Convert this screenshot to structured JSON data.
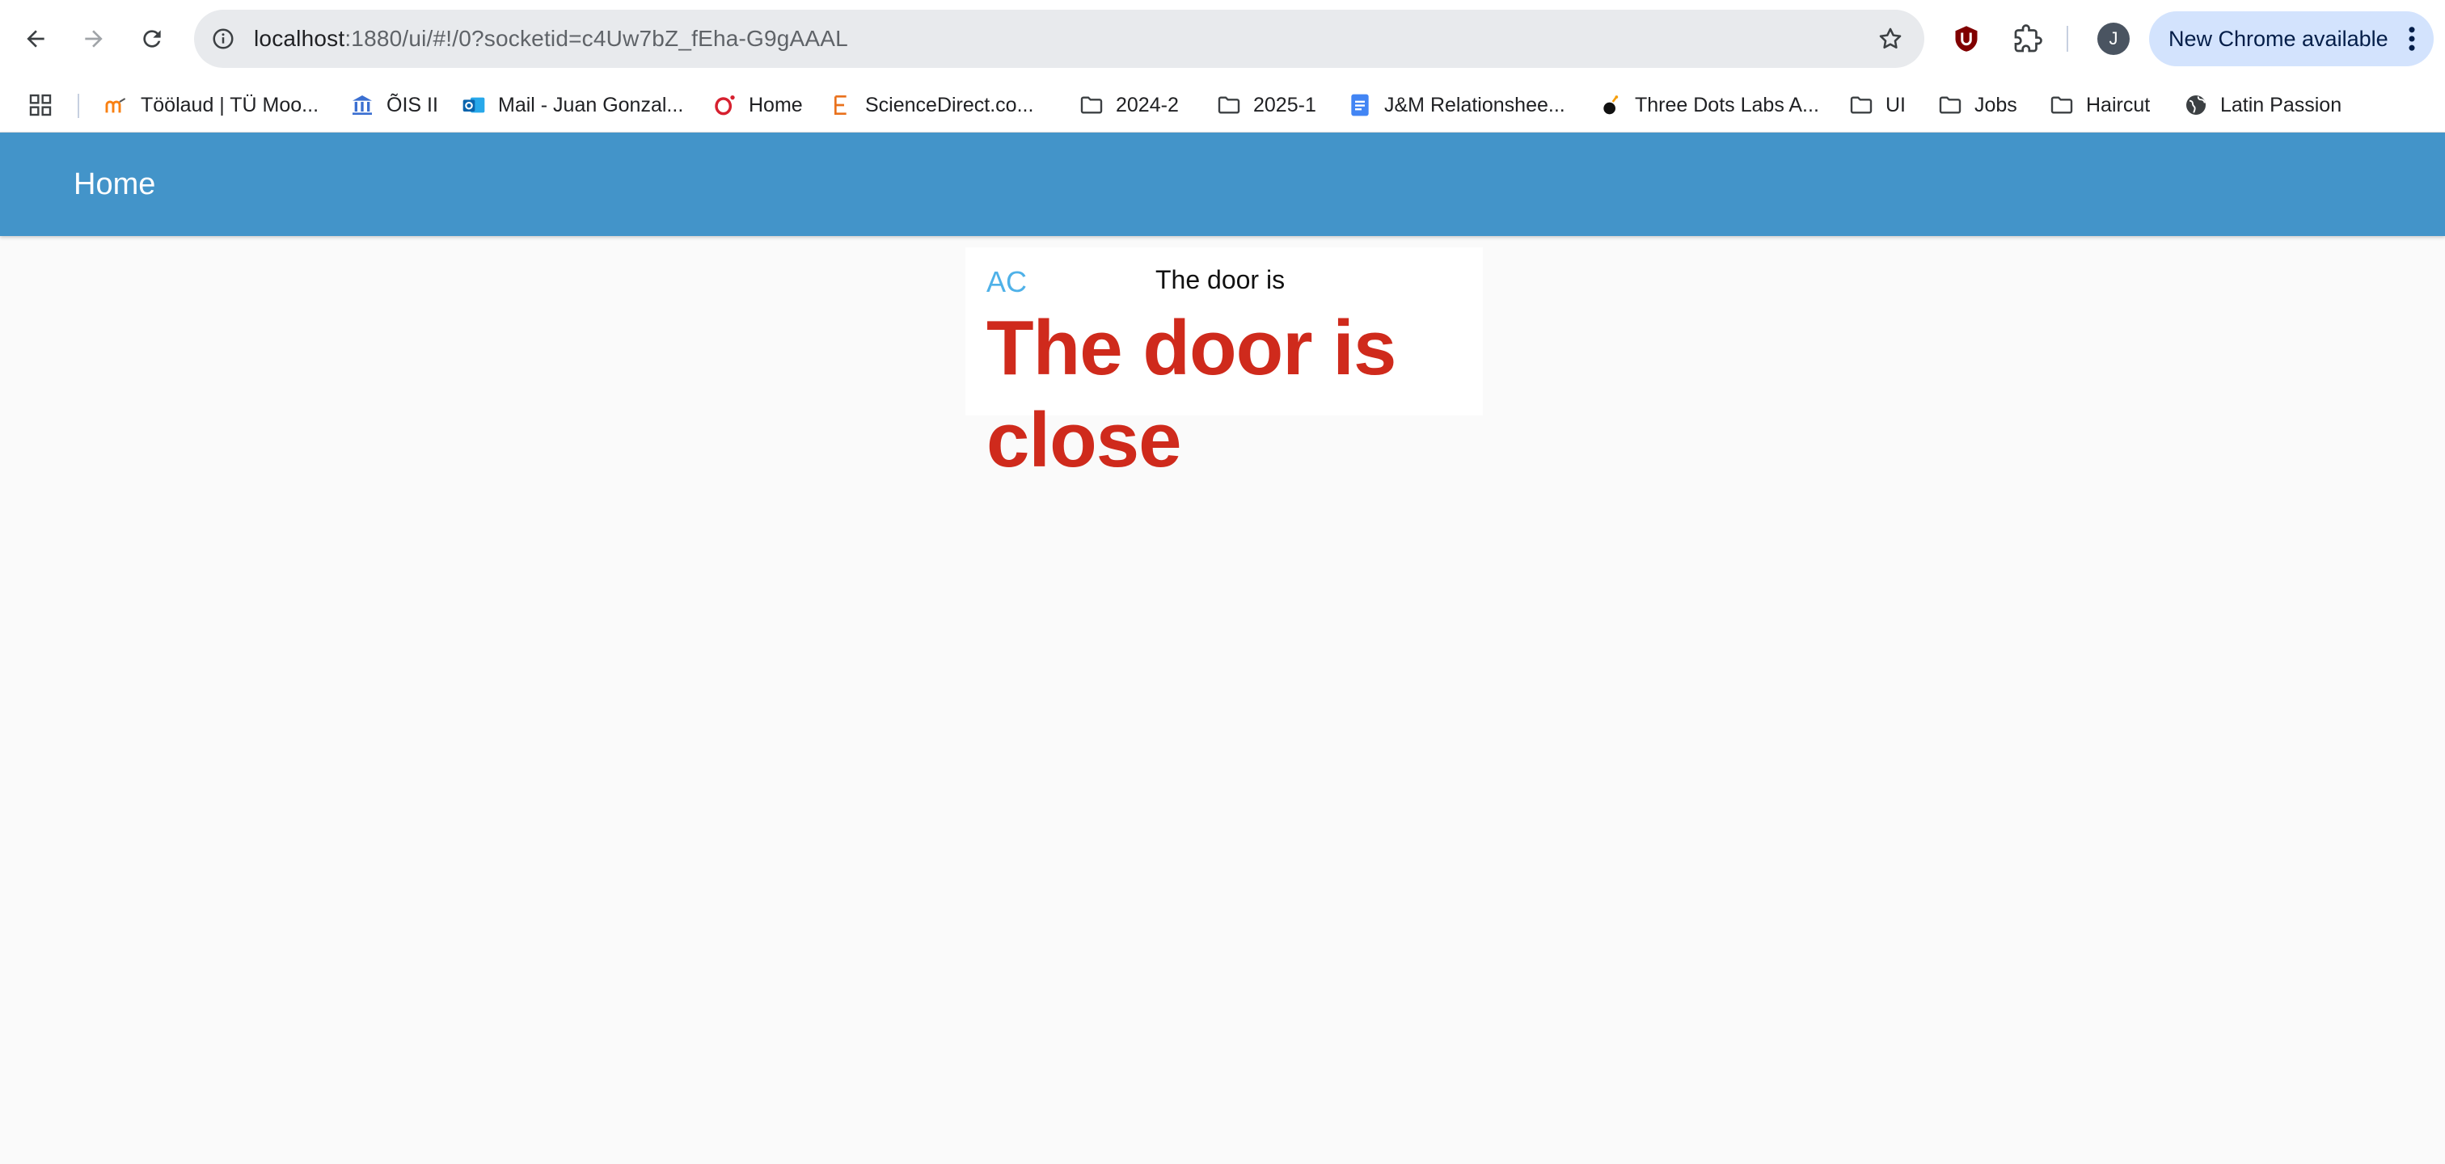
{
  "browser": {
    "url_host": "localhost",
    "url_rest": ":1880/ui/#!/0?socketid=c4Uw7bZ_fEha-G9gAAAL",
    "profile_initial": "J",
    "update_label": "New Chrome available",
    "bookmarks": [
      {
        "label": "Töölaud | TÜ Moo...",
        "icon": "moodle-icon"
      },
      {
        "label": "ÕIS II",
        "icon": "university-icon"
      },
      {
        "label": "Mail - Juan Gonzal...",
        "icon": "outlook-icon"
      },
      {
        "label": "Home",
        "icon": "opera-icon"
      },
      {
        "label": "ScienceDirect.co...",
        "icon": "elsevier-icon"
      },
      {
        "label": "2024-2",
        "icon": "folder-icon"
      },
      {
        "label": "2025-1",
        "icon": "folder-icon"
      },
      {
        "label": "J&M Relationshee...",
        "icon": "docs-icon"
      },
      {
        "label": "Three Dots Labs A...",
        "icon": "threedots-icon"
      },
      {
        "label": "UI",
        "icon": "folder-icon"
      },
      {
        "label": "Jobs",
        "icon": "folder-icon"
      },
      {
        "label": "Haircut",
        "icon": "folder-icon"
      },
      {
        "label": "Latin Passion",
        "icon": "globe-icon"
      }
    ],
    "colors": {
      "chrome_bg": "#ffffff",
      "omnibox_bg": "#e8eaed",
      "update_chip_bg": "#d3e3fd"
    }
  },
  "dashboard": {
    "header_title": "Home",
    "card": {
      "ac_label": "AC",
      "door_label": "The door is"
    },
    "door_status_text": "The door is close",
    "colors": {
      "header_bg": "#4394c9",
      "ac_label": "#4fb1e8",
      "status_text": "#cf2a1c",
      "page_bg": "#fafafa"
    }
  }
}
